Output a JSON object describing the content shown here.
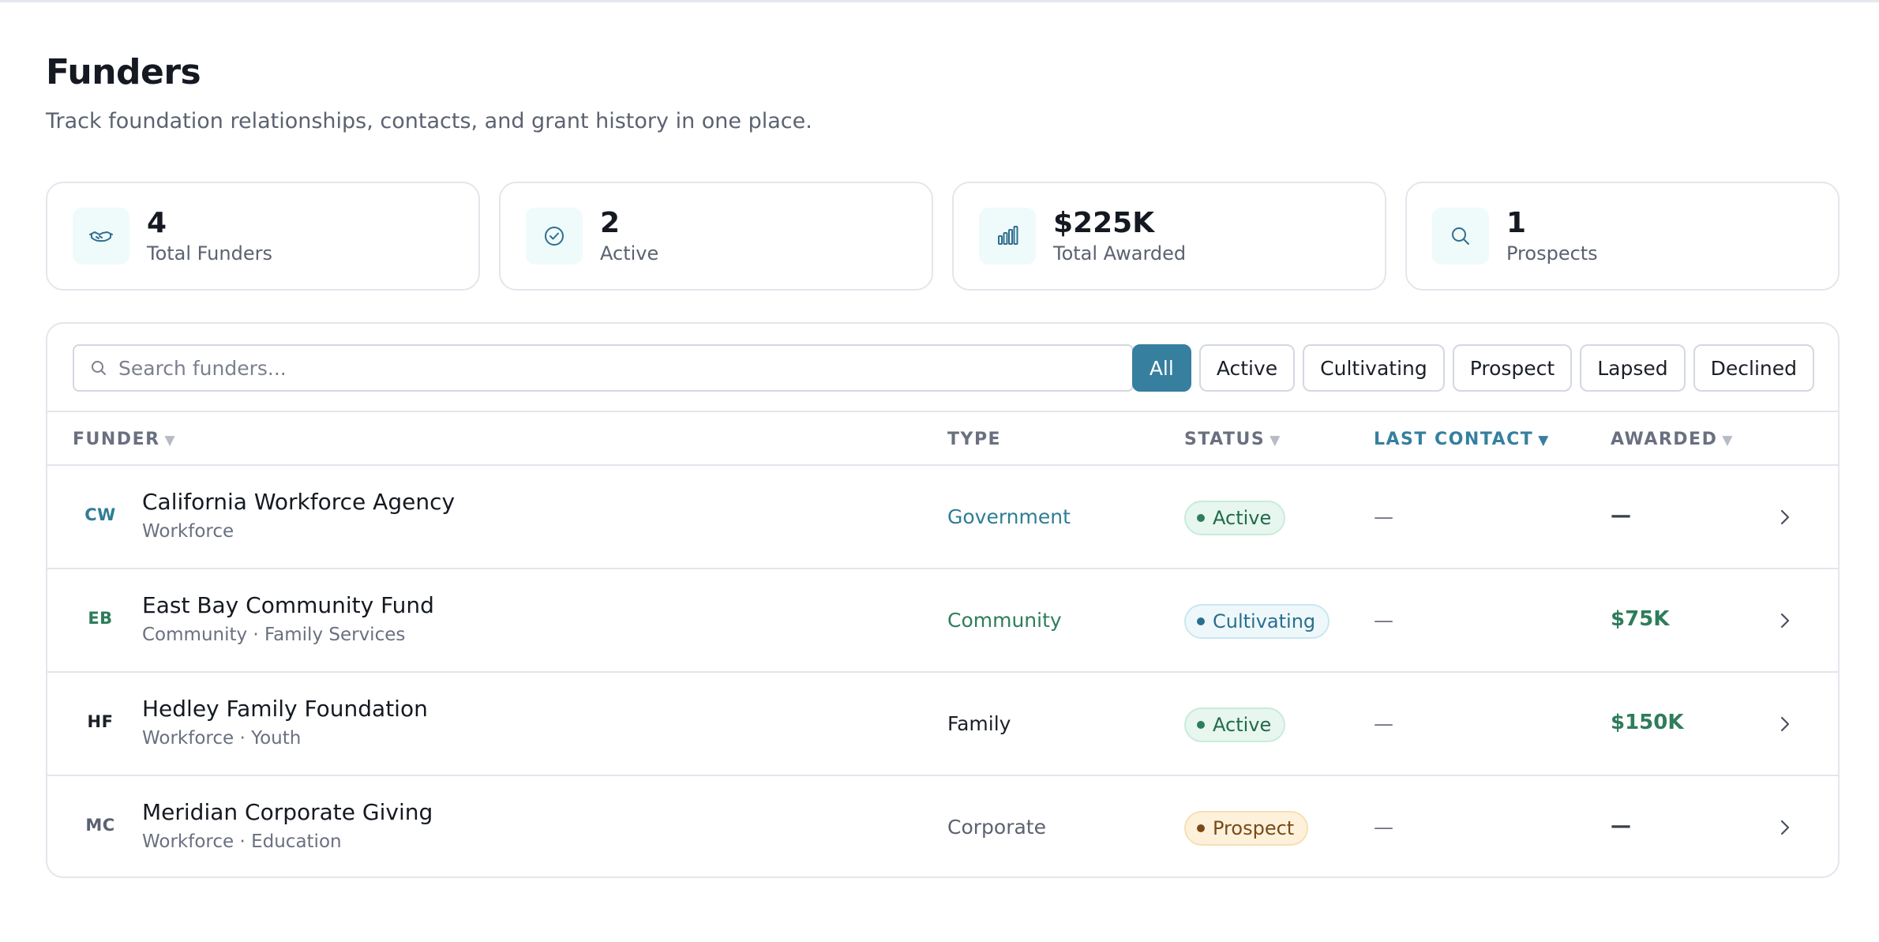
{
  "page": {
    "title": "Funders",
    "subtitle": "Track foundation relationships, contacts, and grant history in one place."
  },
  "stats": [
    {
      "value": "4",
      "label": "Total Funders",
      "icon": "handshake-icon"
    },
    {
      "value": "2",
      "label": "Active",
      "icon": "check-circle-icon"
    },
    {
      "value": "$225K",
      "label": "Total Awarded",
      "icon": "bar-chart-icon"
    },
    {
      "value": "1",
      "label": "Prospects",
      "icon": "search-icon"
    }
  ],
  "search": {
    "placeholder": "Search funders...",
    "value": ""
  },
  "filters": [
    "All",
    "Active",
    "Cultivating",
    "Prospect",
    "Lapsed",
    "Declined"
  ],
  "filters_selected": "All",
  "columns": {
    "funder": "FUNDER",
    "type": "TYPE",
    "status": "STATUS",
    "last_contact": "LAST CONTACT",
    "awarded": "AWARDED",
    "sort_caret": "▼"
  },
  "sorted_column": "last_contact",
  "rows": [
    {
      "initials": "CW",
      "name": "California Workforce Agency",
      "sub": "Workforce",
      "type": "Government",
      "status": "Active",
      "last_contact": "—",
      "awarded": "—"
    },
    {
      "initials": "EB",
      "name": "East Bay Community Fund",
      "sub": "Community · Family Services",
      "type": "Community",
      "status": "Cultivating",
      "last_contact": "—",
      "awarded": "$75K"
    },
    {
      "initials": "HF",
      "name": "Hedley Family Foundation",
      "sub": "Workforce · Youth",
      "type": "Family",
      "status": "Active",
      "last_contact": "—",
      "awarded": "$150K"
    },
    {
      "initials": "MC",
      "name": "Meridian Corporate Giving",
      "sub": "Workforce · Education",
      "type": "Corporate",
      "status": "Prospect",
      "last_contact": "—",
      "awarded": "—"
    }
  ],
  "colors": {
    "accent": "#367f9f",
    "government": "#2f7c96",
    "community": "#2e7d5b",
    "family": "#1b1f27",
    "corporate": "#5b6270",
    "awarded_green": "#2e7d5b",
    "active_bg": "#e7f6ef",
    "active_border": "#c9ebdb",
    "active_dot": "#2e7d5b",
    "active_text": "#226a4b",
    "cultivating_bg": "#eef8fb",
    "cultivating_border": "#cbe6ef",
    "cultivating_dot": "#2a6f8e",
    "cultivating_text": "#2a6f8e",
    "prospect_bg": "#fdf1dc",
    "prospect_border": "#f6dfb2",
    "prospect_dot": "#7a4a16",
    "prospect_text": "#7a4a16"
  }
}
